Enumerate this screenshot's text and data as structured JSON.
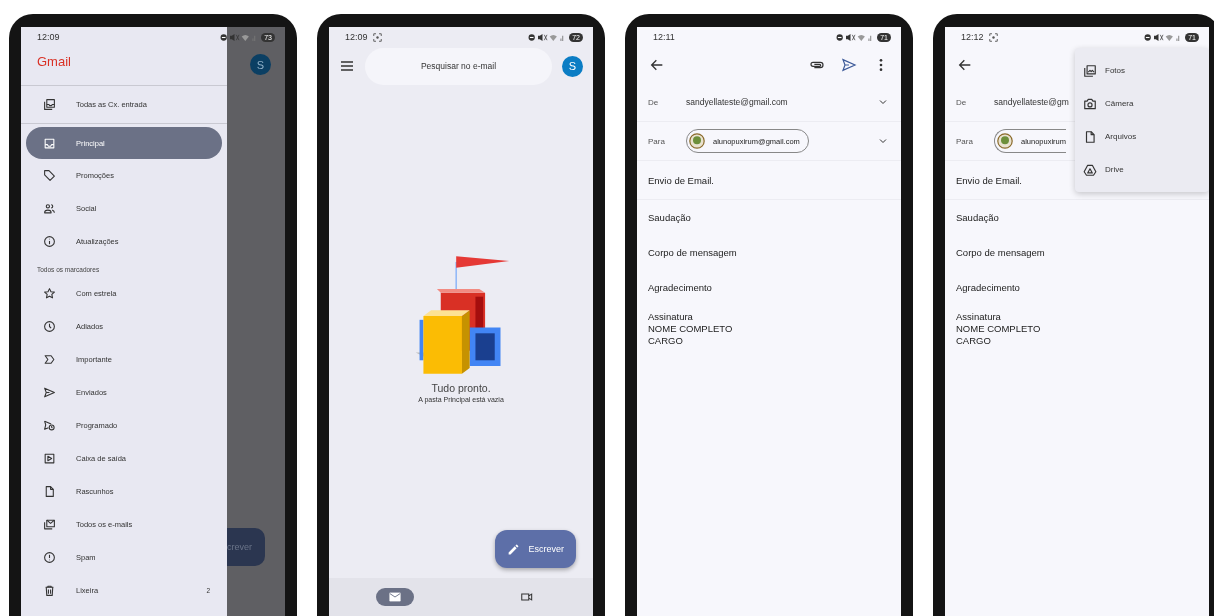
{
  "phones": [
    {
      "kind": "drawer",
      "status": {
        "time": "12:09",
        "battery": "73",
        "screenshot_indicator": false
      },
      "drawer": {
        "title": "Gmail",
        "top_items": [
          {
            "label": "Todas as Cx. entrada",
            "selected": false
          }
        ],
        "items": [
          {
            "label": "Principal",
            "selected": true
          },
          {
            "label": "Promoções",
            "selected": false
          },
          {
            "label": "Social",
            "selected": false
          },
          {
            "label": "Atualizações",
            "selected": false
          }
        ],
        "section_label": "Todos os marcadores",
        "label_items": [
          {
            "label": "Com estrela",
            "selected": false
          },
          {
            "label": "Adiados",
            "selected": false
          },
          {
            "label": "Importante",
            "selected": false
          },
          {
            "label": "Enviados",
            "selected": false
          },
          {
            "label": "Programado",
            "selected": false
          },
          {
            "label": "Caixa de saída",
            "selected": false
          },
          {
            "label": "Rascunhos",
            "selected": false
          },
          {
            "label": "Todos os e-mails",
            "selected": false
          },
          {
            "label": "Spam",
            "selected": false
          },
          {
            "label": "Lixeira",
            "selected": false,
            "count": "2"
          }
        ]
      },
      "behind": {
        "avatar": "S",
        "compose_partial": "crever"
      }
    },
    {
      "kind": "inbox",
      "status": {
        "time": "12:09",
        "battery": "72",
        "screenshot_indicator": true
      },
      "search": {
        "placeholder": "Pesquisar no e-mail"
      },
      "avatar": "S",
      "empty_title": "Tudo pronto.",
      "empty_subtitle": "A pasta Principal está vazia",
      "compose": "Escrever",
      "bottom_nav": [
        {
          "selected": true
        },
        {
          "selected": false
        }
      ]
    },
    {
      "kind": "compose",
      "status": {
        "time": "12:11",
        "battery": "71",
        "screenshot_indicator": false
      },
      "from_label": "De",
      "from": "sandyellateste@gmail.com",
      "to_label": "Para",
      "to": "alunopuxirum@gmail.com",
      "subject": "Envio de Email.",
      "body": [
        "Saudação",
        "Corpo de mensagem",
        "Agradecimento"
      ],
      "signature": [
        "Assinatura",
        "NOME COMPLETO",
        "CARGO"
      ]
    },
    {
      "kind": "compose",
      "status": {
        "time": "12:12",
        "battery": "71",
        "screenshot_indicator": true
      },
      "from_label": "De",
      "from": "sandyellateste@gm",
      "to_label": "Para",
      "to": "alunopuxirum",
      "subject": "Envio de Email.",
      "body": [
        "Saudação",
        "Corpo de mensagem",
        "Agradecimento"
      ],
      "signature": [
        "Assinatura",
        "NOME COMPLETO",
        "CARGO"
      ],
      "attach_menu": [
        "Fotos",
        "Câmera",
        "Arquivos",
        "Drive"
      ]
    }
  ]
}
